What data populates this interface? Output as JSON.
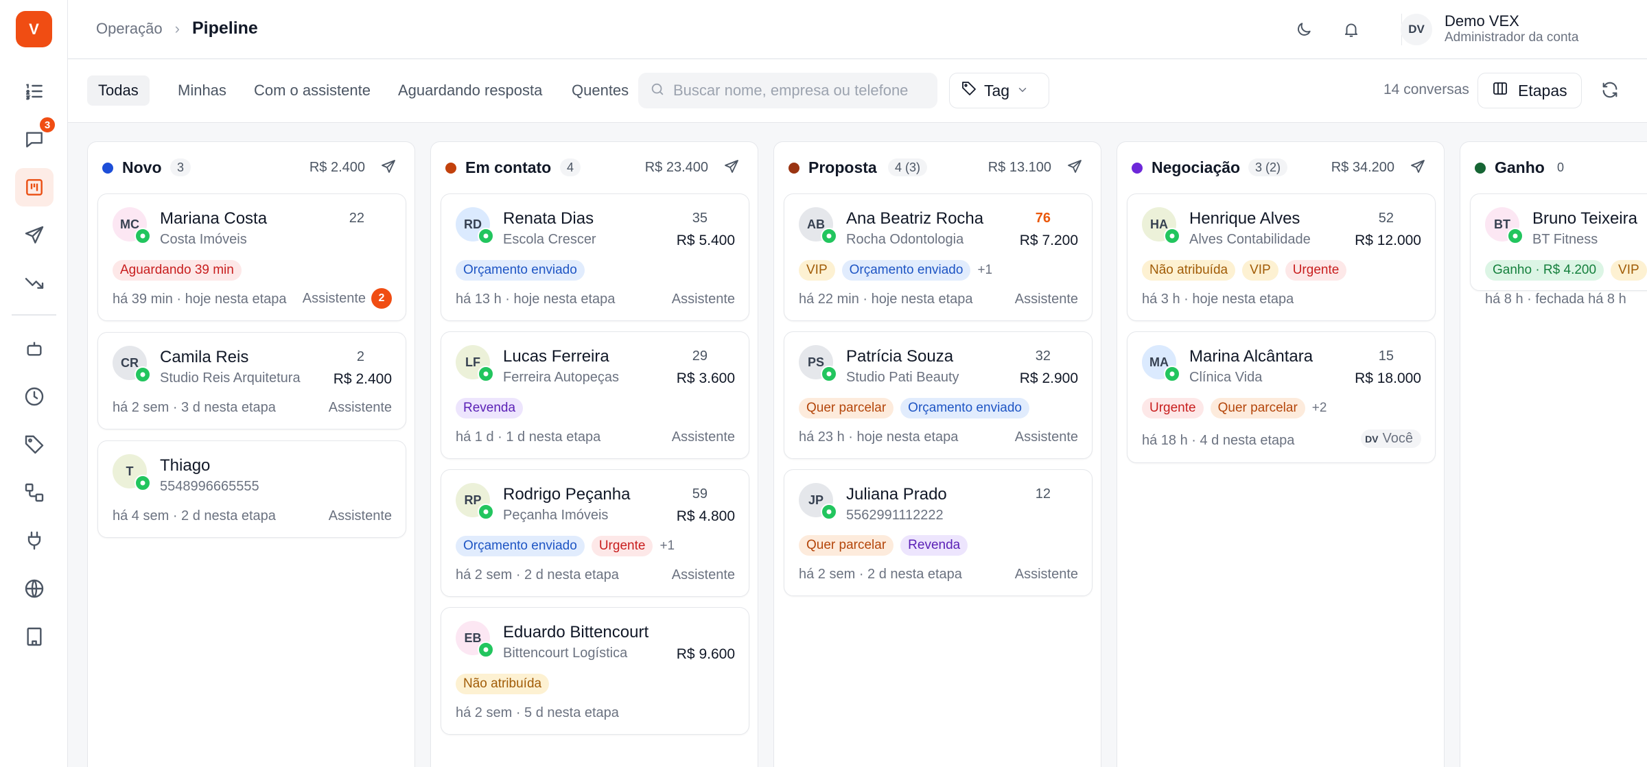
{
  "app": {
    "logo_letter": "V"
  },
  "sidebar": {
    "chat_badge": "3"
  },
  "header": {
    "breadcrumb_parent": "Operação",
    "breadcrumb_current": "Pipeline",
    "user_initials": "DV",
    "user_name": "Demo VEX",
    "user_role": "Administrador da conta"
  },
  "toolbar": {
    "tabs": [
      "Todas",
      "Minhas",
      "Com o assistente",
      "Aguardando resposta",
      "Quentes"
    ],
    "search_placeholder": "Buscar nome, empresa ou telefone",
    "tag_label": "Tag",
    "conversation_count": "14 conversas",
    "stages_label": "Etapas"
  },
  "columns": [
    {
      "title": "Novo",
      "count": "3",
      "total": "R$ 2.400",
      "color": "#1d4ed8",
      "cards": [
        {
          "initials": "MC",
          "avatar_bg": "#fce7f3",
          "name": "Mariana Costa",
          "sub": "Costa Imóveis",
          "score": "22",
          "value": "",
          "tags": [
            {
              "text": "Aguardando 39 min",
              "color": "red"
            }
          ],
          "more": "",
          "footer": "há 39 min · hoje nesta etapa",
          "owner": "Assistente",
          "owner_badge": "2"
        },
        {
          "initials": "CR",
          "avatar_bg": "#e5e7eb",
          "name": "Camila Reis",
          "sub": "Studio Reis Arquitetura",
          "score": "2",
          "value": "R$ 2.400",
          "tags": [],
          "more": "",
          "footer": "há 2 sem · 3 d nesta etapa",
          "owner": "Assistente"
        },
        {
          "initials": "T",
          "avatar_bg": "#ecf1d9",
          "name": "Thiago",
          "sub": "5548996665555",
          "score": "",
          "value": "",
          "tags": [],
          "more": "",
          "footer": "há 4 sem · 2 d nesta etapa",
          "owner": "Assistente"
        }
      ]
    },
    {
      "title": "Em contato",
      "count": "4",
      "total": "R$ 23.400",
      "color": "#c2410c",
      "cards": [
        {
          "initials": "RD",
          "avatar_bg": "#dbeafe",
          "name": "Renata Dias",
          "sub": "Escola Crescer",
          "score": "35",
          "value": "R$ 5.400",
          "tags": [
            {
              "text": "Orçamento enviado",
              "color": "blue"
            }
          ],
          "more": "",
          "footer": "há 13 h · hoje nesta etapa",
          "owner": "Assistente"
        },
        {
          "initials": "LF",
          "avatar_bg": "#ecf1d9",
          "name": "Lucas Ferreira",
          "sub": "Ferreira Autopeças",
          "score": "29",
          "value": "R$ 3.600",
          "tags": [
            {
              "text": "Revenda",
              "color": "purple"
            }
          ],
          "more": "",
          "footer": "há 1 d · 1 d nesta etapa",
          "owner": "Assistente"
        },
        {
          "initials": "RP",
          "avatar_bg": "#ecf1d9",
          "name": "Rodrigo Peçanha",
          "sub": "Peçanha Imóveis",
          "score": "59",
          "value": "R$ 4.800",
          "tags": [
            {
              "text": "Orçamento enviado",
              "color": "blue"
            },
            {
              "text": "Urgente",
              "color": "red"
            }
          ],
          "more": "+1",
          "footer": "há 2 sem · 2 d nesta etapa",
          "owner": "Assistente"
        },
        {
          "initials": "EB",
          "avatar_bg": "#fce7f3",
          "name": "Eduardo Bittencourt",
          "sub": "Bittencourt Logística",
          "score": "",
          "value": "R$ 9.600",
          "tags": [
            {
              "text": "Não atribuída",
              "color": "yellow"
            }
          ],
          "more": "",
          "footer": "há 2 sem · 5 d nesta etapa",
          "owner": ""
        }
      ]
    },
    {
      "title": "Proposta",
      "count": "4 (3)",
      "total": "R$ 13.100",
      "color": "#9a3412",
      "cards": [
        {
          "initials": "AB",
          "avatar_bg": "#e5e7eb",
          "name": "Ana Beatriz Rocha",
          "sub": "Rocha Odontologia",
          "score": "76",
          "hot": true,
          "value": "R$ 7.200",
          "tags": [
            {
              "text": "VIP",
              "color": "yellow"
            },
            {
              "text": "Orçamento enviado",
              "color": "blue"
            }
          ],
          "more": "+1",
          "footer": "há 22 min · hoje nesta etapa",
          "owner": "Assistente"
        },
        {
          "initials": "PS",
          "avatar_bg": "#e5e7eb",
          "name": "Patrícia Souza",
          "sub": "Studio Pati Beauty",
          "score": "32",
          "value": "R$ 2.900",
          "tags": [
            {
              "text": "Quer parcelar",
              "color": "orange"
            },
            {
              "text": "Orçamento enviado",
              "color": "blue"
            }
          ],
          "more": "",
          "footer": "há 23 h · hoje nesta etapa",
          "owner": "Assistente"
        },
        {
          "initials": "JP",
          "avatar_bg": "#e5e7eb",
          "name": "Juliana Prado",
          "sub": "5562991112222",
          "score": "12",
          "value": "",
          "tags": [
            {
              "text": "Quer parcelar",
              "color": "orange"
            },
            {
              "text": "Revenda",
              "color": "purple"
            }
          ],
          "more": "",
          "footer": "há 2 sem · 2 d nesta etapa",
          "owner": "Assistente"
        }
      ]
    },
    {
      "title": "Negociação",
      "count": "3 (2)",
      "total": "R$ 34.200",
      "color": "#6d28d9",
      "cards": [
        {
          "initials": "HA",
          "avatar_bg": "#ecf1d9",
          "name": "Henrique Alves",
          "sub": "Alves Contabilidade",
          "score": "52",
          "value": "R$ 12.000",
          "tags": [
            {
              "text": "Não atribuída",
              "color": "yellow"
            },
            {
              "text": "VIP",
              "color": "yellow"
            },
            {
              "text": "Urgente",
              "color": "red"
            }
          ],
          "more": "",
          "footer": "há 3 h · hoje nesta etapa",
          "owner": ""
        },
        {
          "initials": "MA",
          "avatar_bg": "#dbeafe",
          "name": "Marina Alcântara",
          "sub": "Clínica Vida",
          "score": "15",
          "value": "R$ 18.000",
          "tags": [
            {
              "text": "Urgente",
              "color": "red"
            },
            {
              "text": "Quer parcelar",
              "color": "orange"
            }
          ],
          "more": "+2",
          "footer": "há 18 h · 4 d nesta etapa",
          "owner": "Você",
          "owner_initials": "DV"
        }
      ]
    },
    {
      "title": "Ganho",
      "count": "0",
      "total": "",
      "color": "#166534",
      "cards": [
        {
          "initials": "BT",
          "avatar_bg": "#fce7f3",
          "name": "Bruno Teixeira",
          "sub": "BT Fitness",
          "score": "",
          "value": "",
          "tags": [
            {
              "text": "Ganho · R$ 4.200",
              "color": "green"
            },
            {
              "text": "VIP",
              "color": "yellow"
            }
          ],
          "more": "",
          "footer": "há 8 h · fechada há 8 h",
          "owner": ""
        }
      ]
    }
  ]
}
